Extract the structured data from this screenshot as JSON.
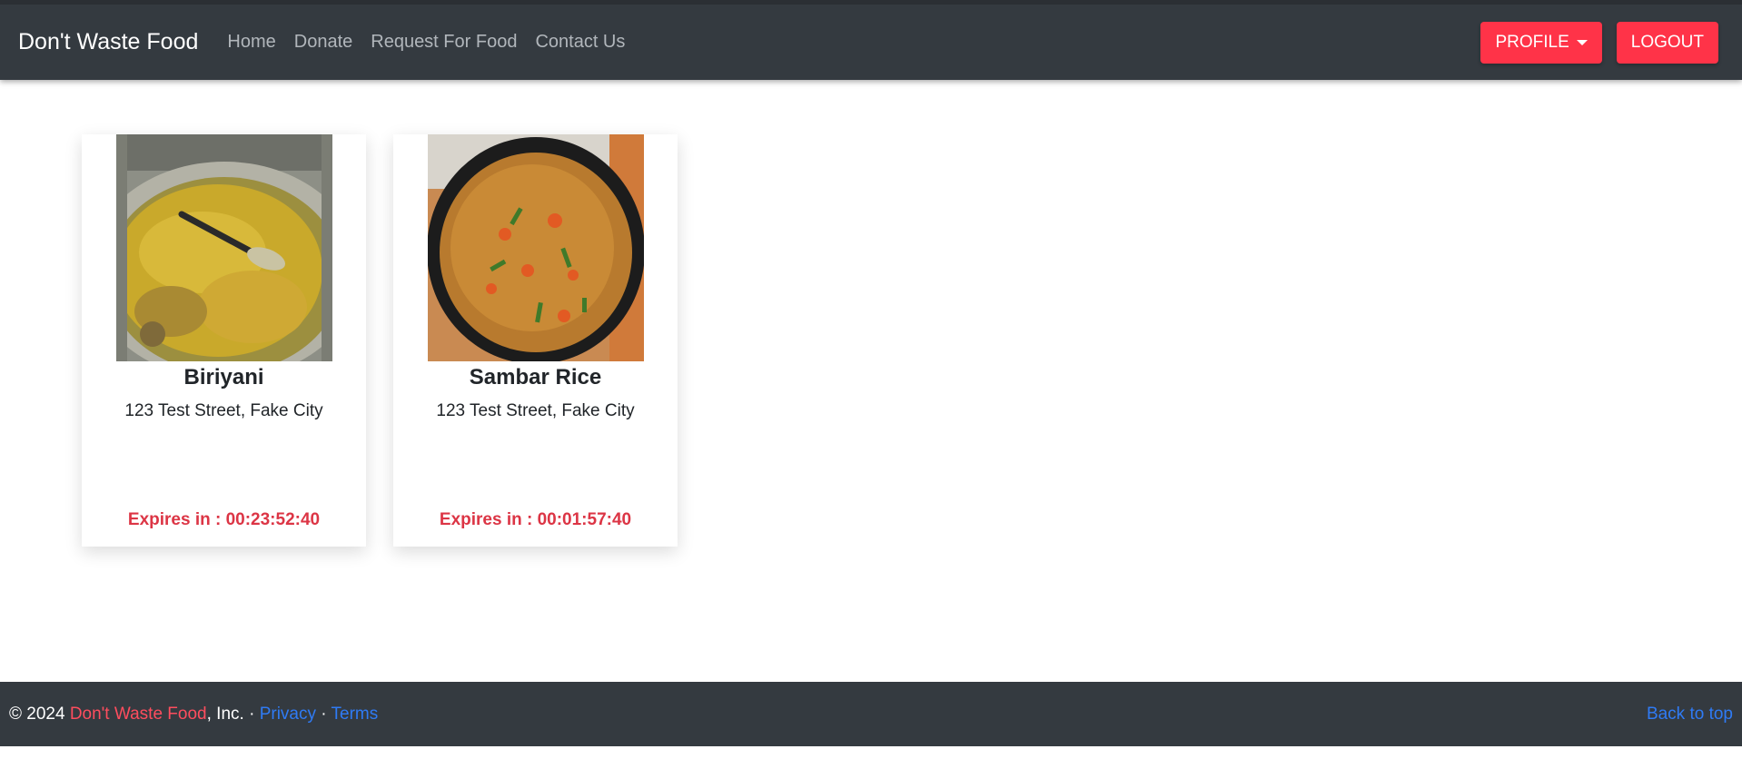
{
  "navbar": {
    "brand": "Don't Waste Food",
    "links": [
      "Home",
      "Donate",
      "Request For Food",
      "Contact Us"
    ],
    "profile_label": "PROFILE",
    "logout_label": "LOGOUT"
  },
  "cards": [
    {
      "name": "Biriyani",
      "address": "123 Test Street, Fake City",
      "expires": "Expires in : 00:23:52:40"
    },
    {
      "name": "Sambar Rice",
      "address": "123 Test Street, Fake City",
      "expires": "Expires in : 00:01:57:40"
    }
  ],
  "footer": {
    "copyright_prefix": "© 2024 ",
    "brand": "Don't Waste Food",
    "suffix": ", Inc. · ",
    "privacy": "Privacy",
    "dot": " · ",
    "terms": "Terms",
    "back_to_top": "Back to top"
  },
  "colors": {
    "navbar_bg": "#343a40",
    "accent_red": "#ff3348",
    "expires_red": "#dc3545",
    "link_blue": "#2f7bf5"
  }
}
